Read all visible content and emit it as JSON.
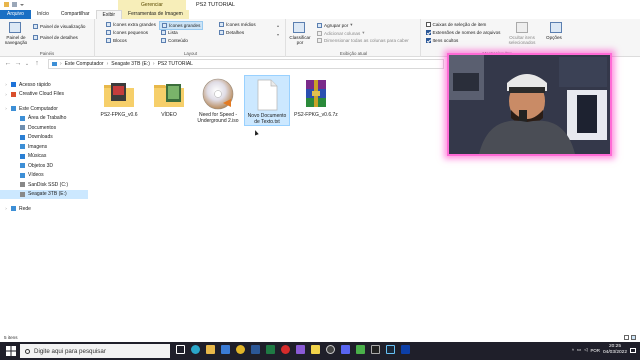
{
  "window": {
    "title": "PS2 TUTORIAL",
    "context_tab": "Gerenciar"
  },
  "ribbon_tabs": [
    "Arquivo",
    "Início",
    "Compartilhar",
    "Exibir",
    "Ferramentas de Imagem"
  ],
  "ribbon": {
    "panes": {
      "nav_pane": "Painel de navegação",
      "preview_pane": "Painel de visualização",
      "details_pane": "Painel de detalhes",
      "group_label": "Painéis"
    },
    "layout": {
      "items": [
        "Ícones extra grandes",
        "Ícones grandes",
        "Ícones médios",
        "Ícones pequenos",
        "Lista",
        "Detalhes",
        "Blocos",
        "Conteúdo"
      ],
      "selected": "Ícones grandes",
      "group_label": "Layout"
    },
    "current_view": {
      "sort": "Classificar por",
      "group_by": "Agrupar por",
      "add_columns": "Adicionar colunas",
      "fit_columns": "Dimensionar todas as colunas para caber",
      "group_label": "Exibição atual"
    },
    "show_hide": {
      "checkboxes": "Caixas de seleção de item",
      "extensions": "Extensões de nomes de arquivos",
      "hidden": "Itens ocultos",
      "hide_selected": "Ocultar itens selecionados",
      "options": "Opções",
      "checkboxes_on": false,
      "extensions_on": true,
      "hidden_on": true,
      "group_label": "Mostrar/ocultar"
    }
  },
  "address": {
    "crumbs": [
      "Este Computador",
      "Seagate 3TB (E:)",
      "PS2 TUTORIAL"
    ]
  },
  "sidebar": {
    "items": [
      {
        "label": "Acesso rápido",
        "icon": "star-icon",
        "indent": 0,
        "color": "#1e73d8"
      },
      {
        "label": "Creative Cloud Files",
        "icon": "cloud-icon",
        "indent": 0,
        "color": "#d94f2b"
      },
      {
        "label": "Este Computador",
        "icon": "computer-icon",
        "indent": 0,
        "color": "#3d8fd6"
      },
      {
        "label": "Área de Trabalho",
        "icon": "desktop-icon",
        "indent": 1,
        "color": "#3d8fd6"
      },
      {
        "label": "Documentos",
        "icon": "document-icon",
        "indent": 1,
        "color": "#6f8fb0"
      },
      {
        "label": "Downloads",
        "icon": "download-icon",
        "indent": 1,
        "color": "#2a7fd4"
      },
      {
        "label": "Imagens",
        "icon": "image-icon",
        "indent": 1,
        "color": "#3d8fd6"
      },
      {
        "label": "Músicas",
        "icon": "music-icon",
        "indent": 1,
        "color": "#2a7fd4"
      },
      {
        "label": "Objetos 3D",
        "icon": "cube-icon",
        "indent": 1,
        "color": "#3d8fd6"
      },
      {
        "label": "Vídeos",
        "icon": "video-icon",
        "indent": 1,
        "color": "#3d8fd6"
      },
      {
        "label": "SanDisk SSD (C:)",
        "icon": "drive-icon",
        "indent": 1,
        "color": "#888888"
      },
      {
        "label": "Seagate 3TB (E:)",
        "icon": "drive-icon",
        "indent": 1,
        "color": "#888888"
      },
      {
        "label": "Rede",
        "icon": "network-icon",
        "indent": 0,
        "color": "#3d8fd6"
      }
    ],
    "selected": "Seagate 3TB (E:)"
  },
  "files": [
    {
      "label": "PS2-FPKG_v0.6",
      "icon": "folder-app-icon",
      "selected": false
    },
    {
      "label": "VÍDEO",
      "icon": "folder-video-icon",
      "selected": false
    },
    {
      "label": "Need for Speed - Underground 2.iso",
      "icon": "disc-iso-icon",
      "selected": false
    },
    {
      "label": "Novo Documento de Texto.txt",
      "icon": "text-file-icon",
      "selected": true
    },
    {
      "label": "PS2-FPKG_v0.6.7z",
      "icon": "rar-archive-icon",
      "selected": false
    }
  ],
  "status": {
    "count": "5 itens"
  },
  "taskbar": {
    "search_placeholder": "Digite aqui para pesquisar",
    "time": "20:25",
    "date": "04/03/2022",
    "lang": "POR"
  },
  "colors": {
    "accent": "#1a6fc4",
    "selection": "#cce8ff",
    "webcam_border": "#ff6ad5",
    "taskbar": "#1f1f2a"
  }
}
